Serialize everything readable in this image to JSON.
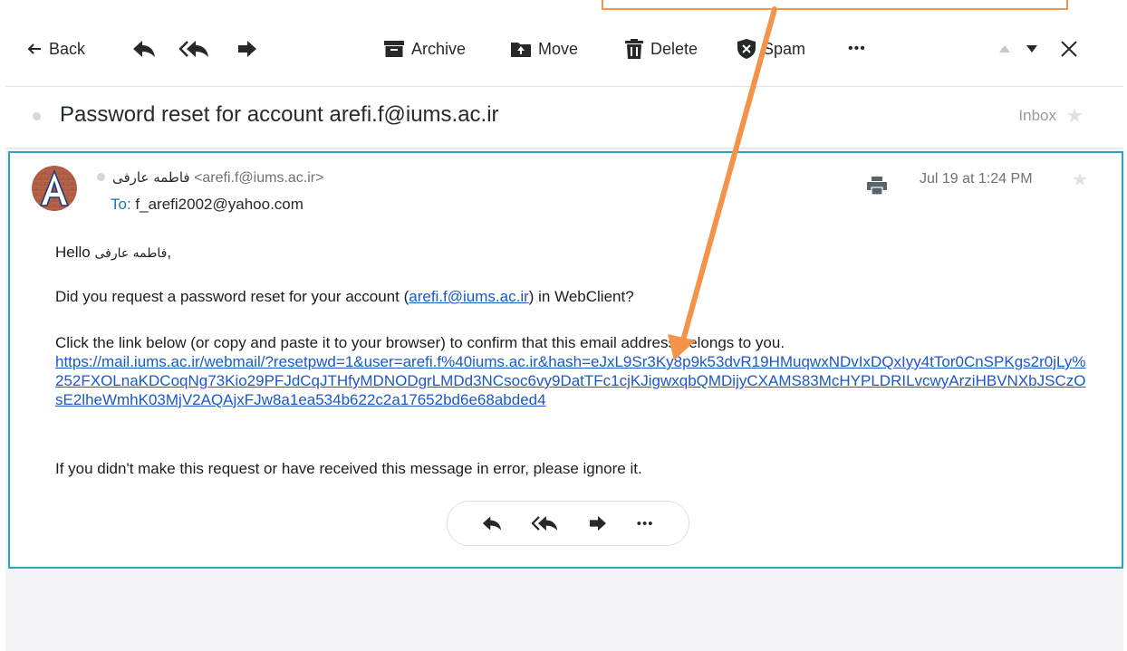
{
  "toolbar": {
    "back_label": "Back",
    "archive_label": "Archive",
    "move_label": "Move",
    "delete_label": "Delete",
    "spam_label": "Spam",
    "more_label": "•••"
  },
  "subject": {
    "title": "Password reset for account arefi.f@iums.ac.ir",
    "folder": "Inbox"
  },
  "message": {
    "sender_name": "فاطمه عارفی",
    "sender_email": "<arefi.f@iums.ac.ir>",
    "to_label": "To:",
    "to_address": "f_arefi2002@yahoo.com",
    "date": "Jul 19 at 1:24 PM",
    "avatar_letter": "A",
    "greeting_prefix": "Hello ",
    "greeting_name": "فاطمه عارفی",
    "greeting_suffix": ",",
    "question_before": "Did you request a password reset for your account (",
    "question_link": "arefi.f@iums.ac.ir",
    "question_after": ") in WebClient?",
    "instruction": "Click the link below (or copy and paste it to your browser) to confirm that this email address belongs to you.",
    "reset_link": "https://mail.iums.ac.ir/webmail/?resetpwd=1&user=arefi.f%40iums.ac.ir&hash=eJxL9Sr3Ky8p9k53dvR19HMuqwxNDvIxDQxIyy4tTor0CnSPKgs2r0jLy%252FXOLnaKDCoqNg73Kio29PFJdCqJTHfyMDNODgrLMDd3NCsoc6vy9DatTFc1cjKJigwxqbQMDijyCXAMS83McHYPLDRILvcwyArziHBVNXbJSCzOsE2lheWmhK03MjV2AQAjxFJw8a1ea534b622c2a17652bd6e68abded4",
    "closing": "If you didn't make this request or have received this message in error, please ignore it.",
    "more_label": "•••"
  },
  "colors": {
    "accent_border": "#2ca3bf",
    "link": "#1b58c8",
    "annotation": "#f3944a"
  }
}
